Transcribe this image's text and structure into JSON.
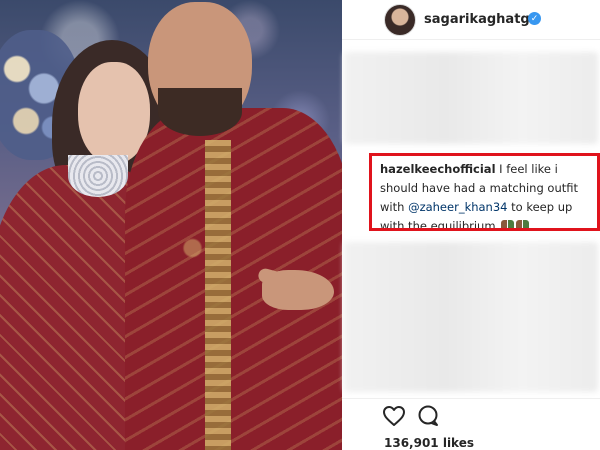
{
  "post": {
    "author": "sagarikaghatge",
    "verified_glyph": "✓",
    "likes": "136,901 likes"
  },
  "highlighted_comment": {
    "user": "hazelkeechofficial",
    "text_before": "I feel like i should have had a matching outfit with",
    "mention": "@zaheer_khan34",
    "text_after": "to keep up with the equilibrium",
    "emoji": [
      "couple-emoji",
      "couple-emoji"
    ],
    "border_color": "#e0131c"
  },
  "icons": {
    "like": "heart-icon",
    "comment": "comment-bubble-icon",
    "verified": "verified-badge-icon"
  },
  "colors": {
    "verified_blue": "#3897f0",
    "highlight_red": "#e0131c",
    "text_dark": "#262626",
    "mention": "#003569"
  }
}
